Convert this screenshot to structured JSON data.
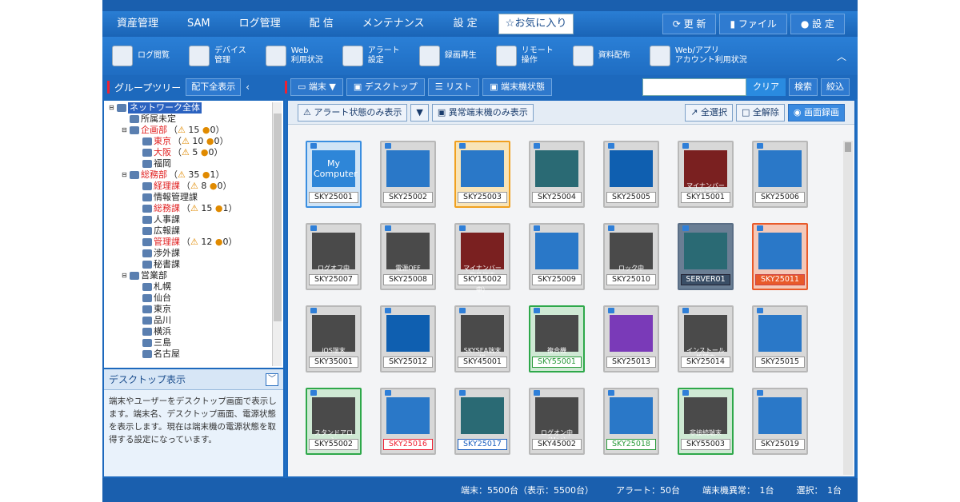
{
  "menu": {
    "items": [
      "資産管理",
      "SAM",
      "ログ管理",
      "配 信",
      "メンテナンス",
      "設 定"
    ],
    "favorites": "お気に入り",
    "right": [
      "更 新",
      "ファイル",
      "設 定"
    ]
  },
  "ribbon": {
    "items": [
      {
        "label": "ログ閲覧",
        "icon": "log-icon"
      },
      {
        "label": "デバイス\n管理",
        "icon": "usb-device-icon"
      },
      {
        "label": "Web\n利用状況",
        "icon": "web-globe-icon"
      },
      {
        "label": "アラート\n設定",
        "icon": "alert-icon"
      },
      {
        "label": "録画再生",
        "icon": "video-play-icon"
      },
      {
        "label": "リモート\n操作",
        "icon": "remote-control-icon"
      },
      {
        "label": "資料配布",
        "icon": "document-icon"
      },
      {
        "label": "Web/アプリ\nアカウント利用状況",
        "icon": "account-usage-icon"
      }
    ]
  },
  "toolbar2": {
    "group_title": "グループツリー",
    "subtree_button": "配下全表示",
    "terminal_dropdown": "端末",
    "tab_desktop": "デスクトップ",
    "tab_list": "リスト",
    "tab_status": "端末機状態",
    "search_placeholder": "",
    "clear_button": "クリア",
    "search_button": "検索",
    "narrow_button": "絞込"
  },
  "tree": [
    {
      "label": "ネットワーク全体",
      "depth": 0,
      "selected": true,
      "red": false,
      "warn": "",
      "err": ""
    },
    {
      "label": "所属未定",
      "depth": 1,
      "selected": false,
      "red": false,
      "warn": "",
      "err": ""
    },
    {
      "label": "企画部",
      "depth": 1,
      "selected": false,
      "red": true,
      "warn": "15",
      "err": "0"
    },
    {
      "label": "東京",
      "depth": 2,
      "selected": false,
      "red": true,
      "warn": "10",
      "err": "0"
    },
    {
      "label": "大阪",
      "depth": 2,
      "selected": false,
      "red": true,
      "warn": "5",
      "err": "0"
    },
    {
      "label": "福岡",
      "depth": 2,
      "selected": false,
      "red": false,
      "warn": "",
      "err": ""
    },
    {
      "label": "総務部",
      "depth": 1,
      "selected": false,
      "red": true,
      "warn": "35",
      "err": "1"
    },
    {
      "label": "経理課",
      "depth": 2,
      "selected": false,
      "red": true,
      "warn": "8",
      "err": "0"
    },
    {
      "label": "情報管理課",
      "depth": 2,
      "selected": false,
      "red": false,
      "warn": "",
      "err": ""
    },
    {
      "label": "総務課",
      "depth": 2,
      "selected": false,
      "red": true,
      "warn": "15",
      "err": "1"
    },
    {
      "label": "人事課",
      "depth": 2,
      "selected": false,
      "red": false,
      "warn": "",
      "err": ""
    },
    {
      "label": "広報課",
      "depth": 2,
      "selected": false,
      "red": false,
      "warn": "",
      "err": ""
    },
    {
      "label": "管理課",
      "depth": 2,
      "selected": false,
      "red": true,
      "warn": "12",
      "err": "0"
    },
    {
      "label": "渉外課",
      "depth": 2,
      "selected": false,
      "red": false,
      "warn": "",
      "err": ""
    },
    {
      "label": "秘書課",
      "depth": 2,
      "selected": false,
      "red": false,
      "warn": "",
      "err": ""
    },
    {
      "label": "営業部",
      "depth": 1,
      "selected": false,
      "red": false,
      "warn": "",
      "err": ""
    },
    {
      "label": "札幌",
      "depth": 2,
      "selected": false,
      "red": false,
      "warn": "",
      "err": ""
    },
    {
      "label": "仙台",
      "depth": 2,
      "selected": false,
      "red": false,
      "warn": "",
      "err": ""
    },
    {
      "label": "東京",
      "depth": 2,
      "selected": false,
      "red": false,
      "warn": "",
      "err": ""
    },
    {
      "label": "品川",
      "depth": 2,
      "selected": false,
      "red": false,
      "warn": "",
      "err": ""
    },
    {
      "label": "横浜",
      "depth": 2,
      "selected": false,
      "red": false,
      "warn": "",
      "err": ""
    },
    {
      "label": "三島",
      "depth": 2,
      "selected": false,
      "red": false,
      "warn": "",
      "err": ""
    },
    {
      "label": "名古屋",
      "depth": 2,
      "selected": false,
      "red": false,
      "warn": "",
      "err": ""
    }
  ],
  "desc": {
    "title": "デスクトップ表示",
    "body": "端末やユーザーをデスクトップ画面で表示します。端末名、デスクトップ画面、電源状態を表示します。現在は端末機の電源状態を取得する設定になっています。"
  },
  "filters": {
    "alert_only": "アラート状態のみ表示",
    "abnormal_only": "異常端末機のみ表示",
    "select_all": "全選択",
    "deselect_all": "全解除",
    "record": "画面録画"
  },
  "tiles": [
    {
      "name": "SKY25001",
      "style": "blue",
      "screen": "mycomp",
      "label": "My\nComputer",
      "big": true,
      "nstyle": ""
    },
    {
      "name": "SKY25002",
      "style": "",
      "screen": "win",
      "label": "",
      "big": false,
      "nstyle": ""
    },
    {
      "name": "SKY25003",
      "style": "orange",
      "screen": "win",
      "label": "",
      "big": false,
      "nstyle": ""
    },
    {
      "name": "SKY25004",
      "style": "",
      "screen": "teal",
      "label": "",
      "big": false,
      "nstyle": ""
    },
    {
      "name": "SKY25005",
      "style": "",
      "screen": "dark",
      "label": "",
      "big": false,
      "nstyle": ""
    },
    {
      "name": "SKY15001",
      "style": "",
      "screen": "maroon",
      "label": "マイナンバー取扱端末\n（電源OFF）",
      "big": false,
      "nstyle": ""
    },
    {
      "name": "SKY25006",
      "style": "",
      "screen": "win",
      "label": "",
      "big": false,
      "nstyle": ""
    },
    {
      "name": "SKY25007",
      "style": "",
      "screen": "gray",
      "label": "ログオフ中",
      "big": false,
      "nstyle": ""
    },
    {
      "name": "SKY25008",
      "style": "",
      "screen": "gray",
      "label": "電源OFF",
      "big": false,
      "nstyle": ""
    },
    {
      "name": "SKY15002",
      "style": "",
      "screen": "maroon",
      "label": "マイナンバー取扱端末\n（ログオン中）",
      "big": false,
      "nstyle": ""
    },
    {
      "name": "SKY25009",
      "style": "",
      "screen": "win",
      "label": "",
      "big": false,
      "nstyle": ""
    },
    {
      "name": "SKY25010",
      "style": "",
      "screen": "gray",
      "label": "ロック中",
      "big": false,
      "nstyle": ""
    },
    {
      "name": "SERVER01",
      "style": "slate",
      "screen": "teal",
      "label": "",
      "big": false,
      "nstyle": "slaten"
    },
    {
      "name": "SKY25011",
      "style": "red",
      "screen": "win",
      "label": "",
      "big": false,
      "nstyle": "redfill"
    },
    {
      "name": "SKY35001",
      "style": "",
      "screen": "gray",
      "label": "iOS端末",
      "big": false,
      "nstyle": ""
    },
    {
      "name": "SKY25012",
      "style": "",
      "screen": "dark",
      "label": "",
      "big": false,
      "nstyle": ""
    },
    {
      "name": "SKY45001",
      "style": "",
      "screen": "gray",
      "label": "SKYSEA端末機\n（Linux）",
      "big": false,
      "nstyle": ""
    },
    {
      "name": "SKY55001",
      "style": "green",
      "screen": "gray",
      "label": "複合機",
      "big": false,
      "nstyle": "greenn"
    },
    {
      "name": "SKY25013",
      "style": "",
      "screen": "purple",
      "label": "",
      "big": false,
      "nstyle": ""
    },
    {
      "name": "SKY25014",
      "style": "",
      "screen": "gray",
      "label": "インストール\n処理中",
      "big": false,
      "nstyle": ""
    },
    {
      "name": "SKY25015",
      "style": "",
      "screen": "win",
      "label": "",
      "big": false,
      "nstyle": ""
    },
    {
      "name": "SKY55002",
      "style": "green",
      "screen": "gray",
      "label": "スタンドアロン\n端末",
      "big": false,
      "nstyle": ""
    },
    {
      "name": "SKY25016",
      "style": "",
      "screen": "win",
      "label": "",
      "big": false,
      "nstyle": "redn"
    },
    {
      "name": "SKY25017",
      "style": "",
      "screen": "teal",
      "label": "",
      "big": false,
      "nstyle": "bluen"
    },
    {
      "name": "SKY45002",
      "style": "",
      "screen": "gray",
      "label": "ログオン中\n（Mac）",
      "big": false,
      "nstyle": ""
    },
    {
      "name": "SKY25018",
      "style": "",
      "screen": "win",
      "label": "",
      "big": false,
      "nstyle": "greenn"
    },
    {
      "name": "SKY55003",
      "style": "green",
      "screen": "gray",
      "label": "非接続端末",
      "big": false,
      "nstyle": ""
    },
    {
      "name": "SKY25019",
      "style": "",
      "screen": "win",
      "label": "",
      "big": false,
      "nstyle": ""
    }
  ],
  "status": {
    "total": "端末：5500台（表示：5500台）",
    "alert": "アラート：50台",
    "abnormal": "端末機異常：　1台",
    "selected": "選択：　1台"
  }
}
